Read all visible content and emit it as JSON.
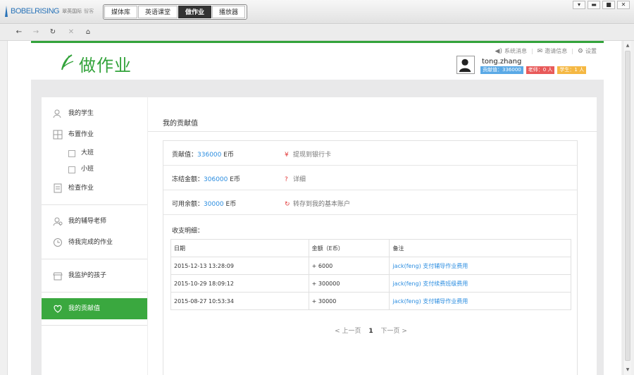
{
  "app": {
    "logo": "BOBELRISING",
    "sub": "翠英国际",
    "sub2": "智客"
  },
  "nav_tabs": [
    "媒体库",
    "英语课堂",
    "做作业",
    "播放器"
  ],
  "active_tab_index": 2,
  "page": {
    "title": "做作业"
  },
  "toplinks": {
    "messages": "系统消息",
    "invite": "邀请信息",
    "settings": "设置"
  },
  "user": {
    "name": "tong.zhang",
    "badges": [
      {
        "text": "贡献值：336000",
        "color": "#5aa9e6"
      },
      {
        "text": "老师：0 人",
        "color": "#e85a5a"
      },
      {
        "text": "学生：1 人",
        "color": "#f5b843"
      }
    ]
  },
  "sidebar": {
    "groups": [
      {
        "items": [
          {
            "label": "我的学生",
            "icon": "students-icon"
          },
          {
            "label": "布置作业",
            "icon": "assign-icon",
            "subitems": [
              "大班",
              "小班"
            ]
          },
          {
            "label": "检查作业",
            "icon": "check-icon"
          }
        ]
      },
      {
        "items": [
          {
            "label": "我的辅导老师",
            "icon": "tutor-icon"
          },
          {
            "label": "待我完成的作业",
            "icon": "todo-icon"
          }
        ]
      },
      {
        "items": [
          {
            "label": "我监护的孩子",
            "icon": "children-icon"
          }
        ]
      },
      {
        "items": [
          {
            "label": "我的贡献值",
            "icon": "heart-icon",
            "active": true
          }
        ]
      }
    ]
  },
  "main": {
    "title": "我的贡献值",
    "rows": [
      {
        "label": "贡献值：",
        "value": "336000",
        "unit": " E币",
        "action": "提现到银行卡",
        "action_icon": "¥"
      },
      {
        "label": "冻结金额：",
        "value": "306000",
        "unit": " E币",
        "action": "详细",
        "action_icon": "?"
      },
      {
        "label": "可用余额：",
        "value": "30000",
        "unit": " E币",
        "action": "转存到我的基本账户",
        "action_icon": "↻"
      }
    ],
    "detail_label": "收支明细：",
    "table": {
      "headers": [
        "日期",
        "金额（E币）",
        "备注"
      ],
      "rows": [
        [
          "2015-12-13 13:28:09",
          "+ 6000",
          "jack(feng) 支付辅导作业费用"
        ],
        [
          "2015-10-29 18:09:12",
          "+ 300000",
          "jack(feng) 支付续费班级费用"
        ],
        [
          "2015-08-27 10:53:34",
          "+ 30000",
          "jack(feng) 支付辅导作业费用"
        ]
      ]
    },
    "pager": {
      "prev": "< 上一页",
      "current": "1",
      "next": "下一页 >"
    }
  }
}
